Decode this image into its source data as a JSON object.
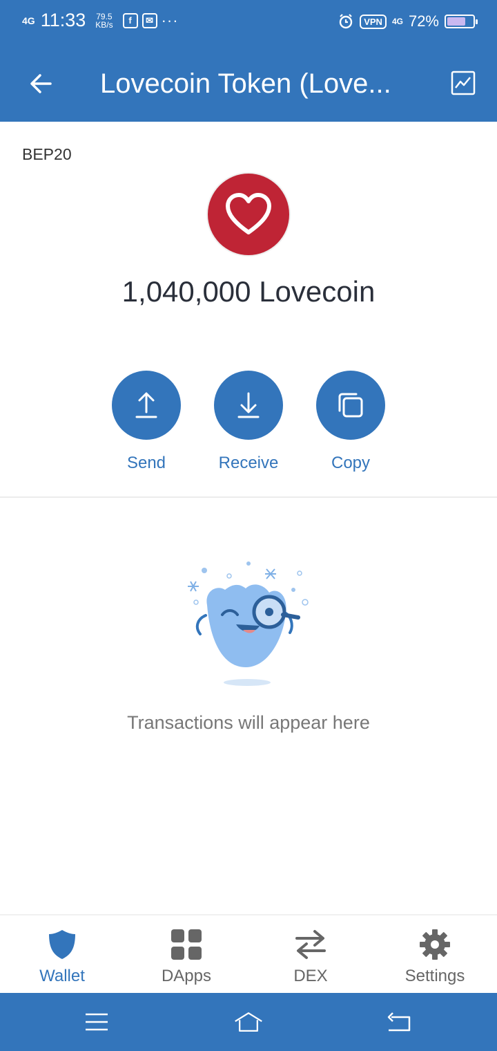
{
  "status_bar": {
    "network": "4G",
    "time": "11:33",
    "speed_value": "79.5",
    "speed_unit": "KB/s",
    "overflow": "···",
    "vpn": "VPN",
    "network_right": "4G",
    "battery": "72%",
    "battery_level": 0.72
  },
  "header": {
    "title": "Lovecoin Token (Love...",
    "back_icon": "arrow-left-icon",
    "chart_icon": "chart-icon"
  },
  "token": {
    "network": "BEP20",
    "balance": "1,040,000 Lovecoin",
    "logo_color": "#bf2435"
  },
  "actions": [
    {
      "label": "Send",
      "icon": "arrow-up-icon"
    },
    {
      "label": "Receive",
      "icon": "arrow-down-icon"
    },
    {
      "label": "Copy",
      "icon": "copy-icon"
    }
  ],
  "empty_state": {
    "message": "Transactions will appear here"
  },
  "tabs": [
    {
      "label": "Wallet",
      "icon": "shield-icon",
      "active": true
    },
    {
      "label": "DApps",
      "icon": "grid-icon",
      "active": false
    },
    {
      "label": "DEX",
      "icon": "swap-icon",
      "active": false
    },
    {
      "label": "Settings",
      "icon": "gear-icon",
      "active": false
    }
  ],
  "colors": {
    "accent": "#3375bb",
    "inactive": "#666666",
    "background": "#ffffff"
  }
}
